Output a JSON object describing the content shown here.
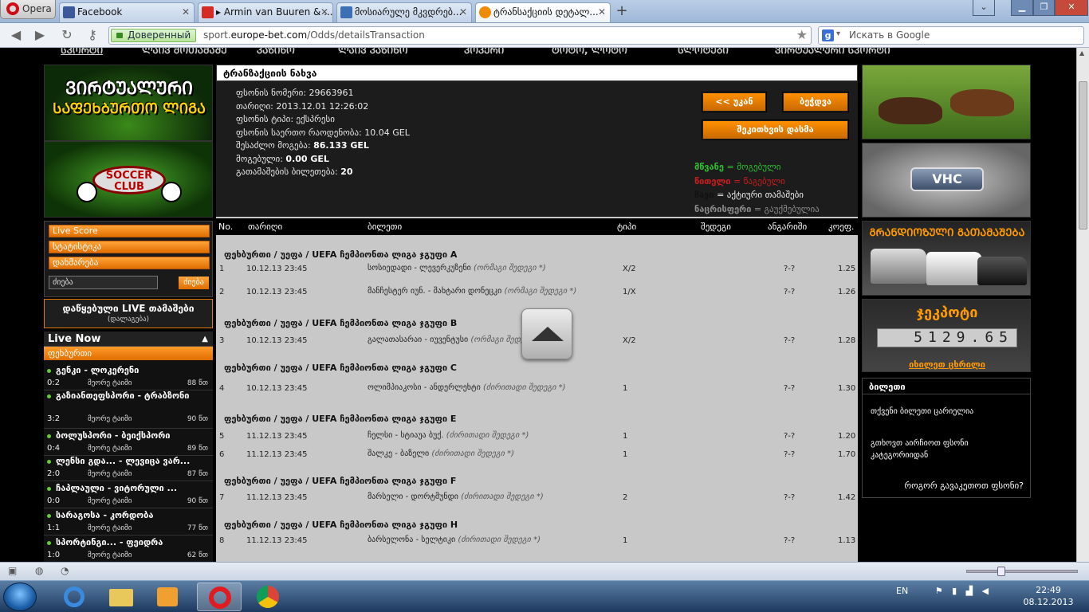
{
  "browser": {
    "opera_label": "Opera",
    "tabs": [
      {
        "label": "Facebook",
        "favicon_color": "#3b5998"
      },
      {
        "label": "▸ Armin van Buuren & ...",
        "favicon_color": "#d62b25"
      },
      {
        "label": "მოსიარულე მკვდრებ...",
        "favicon_color": "#3d6fb5"
      },
      {
        "label": "ტრანსაქციის დეტალ...",
        "favicon_color": "#f08a00"
      }
    ],
    "secure_label": "Доверенный",
    "url_prefix": "sport.",
    "url_domain": "europe-bet.com",
    "url_path": "/Odds/detailsTransaction",
    "search_provider": "g",
    "search_placeholder": "Искать в Google"
  },
  "site_nav": [
    "ᲡᲞᲝᲠᲢᲘ",
    "ᲚᲐᲘᲕ ᲛᲝᲗᲐᲛᲐᲨᲔ",
    "ᲙᲐᲖᲘᲜᲝ",
    "ᲚᲐᲘᲕ ᲙᲐᲖᲘᲜᲝ",
    "ᲞᲝᲙᲔᲠᲘ",
    "ᲢᲝᲢᲝ, ᲚᲝᲢᲝ",
    "ᲡᲚᲝᲢᲔᲑᲘ",
    "ᲕᲘᲠᲢᲣᲐᲚᲣᲠᲘ ᲡᲞᲝᲠᲢᲘ"
  ],
  "left": {
    "virtual_banner_line1": "ᲕᲘᲠᲢᲣᲐᲚᲣᲠᲘ",
    "virtual_banner_line2": "ᲡᲐᲤᲔᲮᲑᲣᲠᲗᲝ ᲚᲘᲒᲐ",
    "soccer_club_logo": "SOCCER CLUB",
    "links": [
      "Live Score",
      "სტატისტიკა",
      "დახმარება"
    ],
    "search_value": "ძიება",
    "search_button": "ძიება",
    "fav_live_title": "დაწყებული LIVE თამაშები",
    "fav_live_sub": "(დალაგება)",
    "live_now_title": "Live Now",
    "live_now_category": "ფეხბურთი",
    "live_matches": [
      {
        "name": "გენკი - ლოკერენი",
        "score": "0:2",
        "period": "მეორე ტაიმი",
        "minute": "88 წთ"
      },
      {
        "name": "გაზიანთეფსპორი - ტრაბზონი",
        "score": "3:2",
        "period": "მეორე ტაიმი",
        "minute": "90 წთ"
      },
      {
        "name": "ბოლუსპორი - ბეიქსპორი",
        "score": "0:4",
        "period": "მეორე ტაიმი",
        "minute": "89 წთ"
      },
      {
        "name": "ლენსი გდა... - ლევიცა ვარ...",
        "score": "2:0",
        "period": "მეორე ტაიმი",
        "minute": "87 წთ"
      },
      {
        "name": "ჩაპლაული - ვიტორული ...",
        "score": "0:0",
        "period": "მეორე ტაიმი",
        "minute": "90 წთ"
      },
      {
        "name": "სარაგოსა - კორდობა",
        "score": "1:1",
        "period": "მეორე ტაიმი",
        "minute": "77 წთ"
      },
      {
        "name": "სპორტინგი... - ფეიდრა",
        "score": "1:0",
        "period": "მეორე ტაიმი",
        "minute": "62 წთ"
      }
    ]
  },
  "slip": {
    "header": "ტრანზაქციის ნახვა",
    "lines": [
      {
        "label": "ფსონის ნომერი:",
        "value": "29663961",
        "bold": false
      },
      {
        "label": "თარიღი:",
        "value": "2013.12.01 12:26:02",
        "bold": false
      },
      {
        "label": "ფსონის ტიპი:",
        "value": "ექსპრესი",
        "bold": false
      },
      {
        "label": "ფსონის საერთო რაოდენობა:",
        "value": "10.04 GEL",
        "bold": false
      },
      {
        "label": "შესაძლო მოგება:",
        "value": "86.133 GEL",
        "bold": true
      },
      {
        "label": "მოგებული:",
        "value": "0.00 GEL",
        "bold": true
      },
      {
        "label": "გათამაშების ბილეთება:",
        "value": "20",
        "bold": true
      }
    ],
    "back_button": "<< უკან",
    "print_button": "ბეჭდვა",
    "complaint_button": "შეკითხვის დასმა",
    "legend": [
      {
        "word": "მწვანე",
        "rest": " = მოგებული",
        "color": "#2fbf2f"
      },
      {
        "word": "წითელი",
        "rest": " = წაგებული",
        "color": "#d01c1c"
      },
      {
        "word": "შავი",
        "rest": " = აქტიური თამაშები",
        "color": "#111111"
      },
      {
        "word": "ნაცრისფერი",
        "rest": " = გაუქმებულია",
        "color": "#8c8c8c"
      },
      {
        "word": "✔",
        "rest": " = ლობი",
        "color": "#2fbf2f"
      }
    ]
  },
  "table": {
    "headers": {
      "no": "No.",
      "date": "თარიღი",
      "event": "ბილეთი",
      "type": "ტიპი",
      "result": "შედეგი",
      "calc": "ანგარიში",
      "odds": "კოეფ."
    },
    "groups": [
      {
        "title": "ფეხბურთი / უეფა / UEFA ჩემპიონთა ლიგა ჯგუფი A",
        "rows": [
          {
            "no": "1",
            "date": "10.12.13 23:45",
            "event": "სოსიედადი - ლევერკუზენი",
            "note": "(ორმაგი შედეგი *)",
            "type": "X/2",
            "calc": "?-?",
            "odds": "1.25"
          },
          {
            "no": "2",
            "date": "10.12.13 23:45",
            "event": "მანჩესტერ იუნ. - შახტარი დონეცკი",
            "note": "(ორმაგი შედეგი *)",
            "type": "1/X",
            "calc": "?-?",
            "odds": "1.26"
          }
        ]
      },
      {
        "title": "ფეხბურთი / უეფა / UEFA ჩემპიონთა ლიგა ჯგუფი B",
        "rows": [
          {
            "no": "3",
            "date": "10.12.13 23:45",
            "event": "გალათასარაი - იუვენტუსი",
            "note": "(ორმაგი შედეგი *)",
            "type": "X/2",
            "calc": "?-?",
            "odds": "1.28"
          }
        ]
      },
      {
        "title": "ფეხბურთი / უეფა / UEFA ჩემპიონთა ლიგა ჯგუფი C",
        "rows": [
          {
            "no": "4",
            "date": "10.12.13 23:45",
            "event": "ოლიმპიაკოსი - ანდერლეხტი",
            "note": "(ძირითადი შედეგი *)",
            "type": "1",
            "calc": "?-?",
            "odds": "1.30"
          }
        ]
      },
      {
        "title": "ფეხბურთი / უეფა / UEFA ჩემპიონთა ლიგა ჯგუფი E",
        "rows": [
          {
            "no": "5",
            "date": "11.12.13 23:45",
            "event": "ჩელსი - სტიაუა ბუქ.",
            "note": "(ძირითადი შედეგი *)",
            "type": "1",
            "calc": "?-?",
            "odds": "1.20"
          },
          {
            "no": "6",
            "date": "11.12.13 23:45",
            "event": "შალკე - ბაზელი",
            "note": "(ძირითადი შედეგი *)",
            "type": "1",
            "calc": "?-?",
            "odds": "1.70"
          }
        ]
      },
      {
        "title": "ფეხბურთი / უეფა / UEFA ჩემპიონთა ლიგა ჯგუფი F",
        "rows": [
          {
            "no": "7",
            "date": "11.12.13 23:45",
            "event": "მარსელი - დორტმუნდი",
            "note": "(ძირითადი შედეგი *)",
            "type": "2",
            "calc": "?-?",
            "odds": "1.42"
          }
        ]
      },
      {
        "title": "ფეხბურთი / უეფა / UEFA ჩემპიონთა ლიგა ჯგუფი H",
        "rows": [
          {
            "no": "8",
            "date": "11.12.13 23:45",
            "event": "ბარსელონა - სელტიკი",
            "note": "(ძირითადი შედეგი *)",
            "type": "1",
            "calc": "?-?",
            "odds": "1.13"
          }
        ]
      }
    ]
  },
  "right": {
    "vhc_logo": "VHC",
    "grand_title": "ᲒᲠᲐᲜᲓᲘᲝᲖᲣᲚᲘ ᲒᲐᲗᲐᲛᲐᲨᲔᲑᲐ",
    "jackpot_title": "ჯეკპოტი",
    "jackpot_value": "5129.65",
    "jackpot_link": "იხილეთ ცხრილი",
    "betslip_title": "ბილეთი",
    "betslip_empty": "თქვენი ბილეთი ცარიელია",
    "betslip_choose": "გთხოვთ აირჩიოთ ფსონი კატეგორიიდან",
    "betslip_how": "როგორ გავაკეთოთ ფსონი?"
  },
  "taskbar": {
    "lang": "EN",
    "time": "22:49",
    "date": "08.12.2013"
  }
}
